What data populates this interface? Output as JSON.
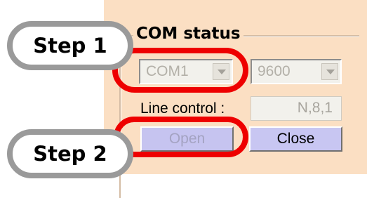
{
  "annotations": {
    "step1_label": "Step 1",
    "step2_label": "Step 2",
    "highlight_color": "#ee0000"
  },
  "com_status": {
    "title": "COM status",
    "port_select_value": "COM1",
    "baud_select_value": "9600",
    "line_control_label": "Line control :",
    "line_control_value": "N,8,1",
    "open_button_label": "Open",
    "close_button_label": "Close",
    "panel_color": "#fbdfc3",
    "button_color": "#c8c6f2"
  }
}
